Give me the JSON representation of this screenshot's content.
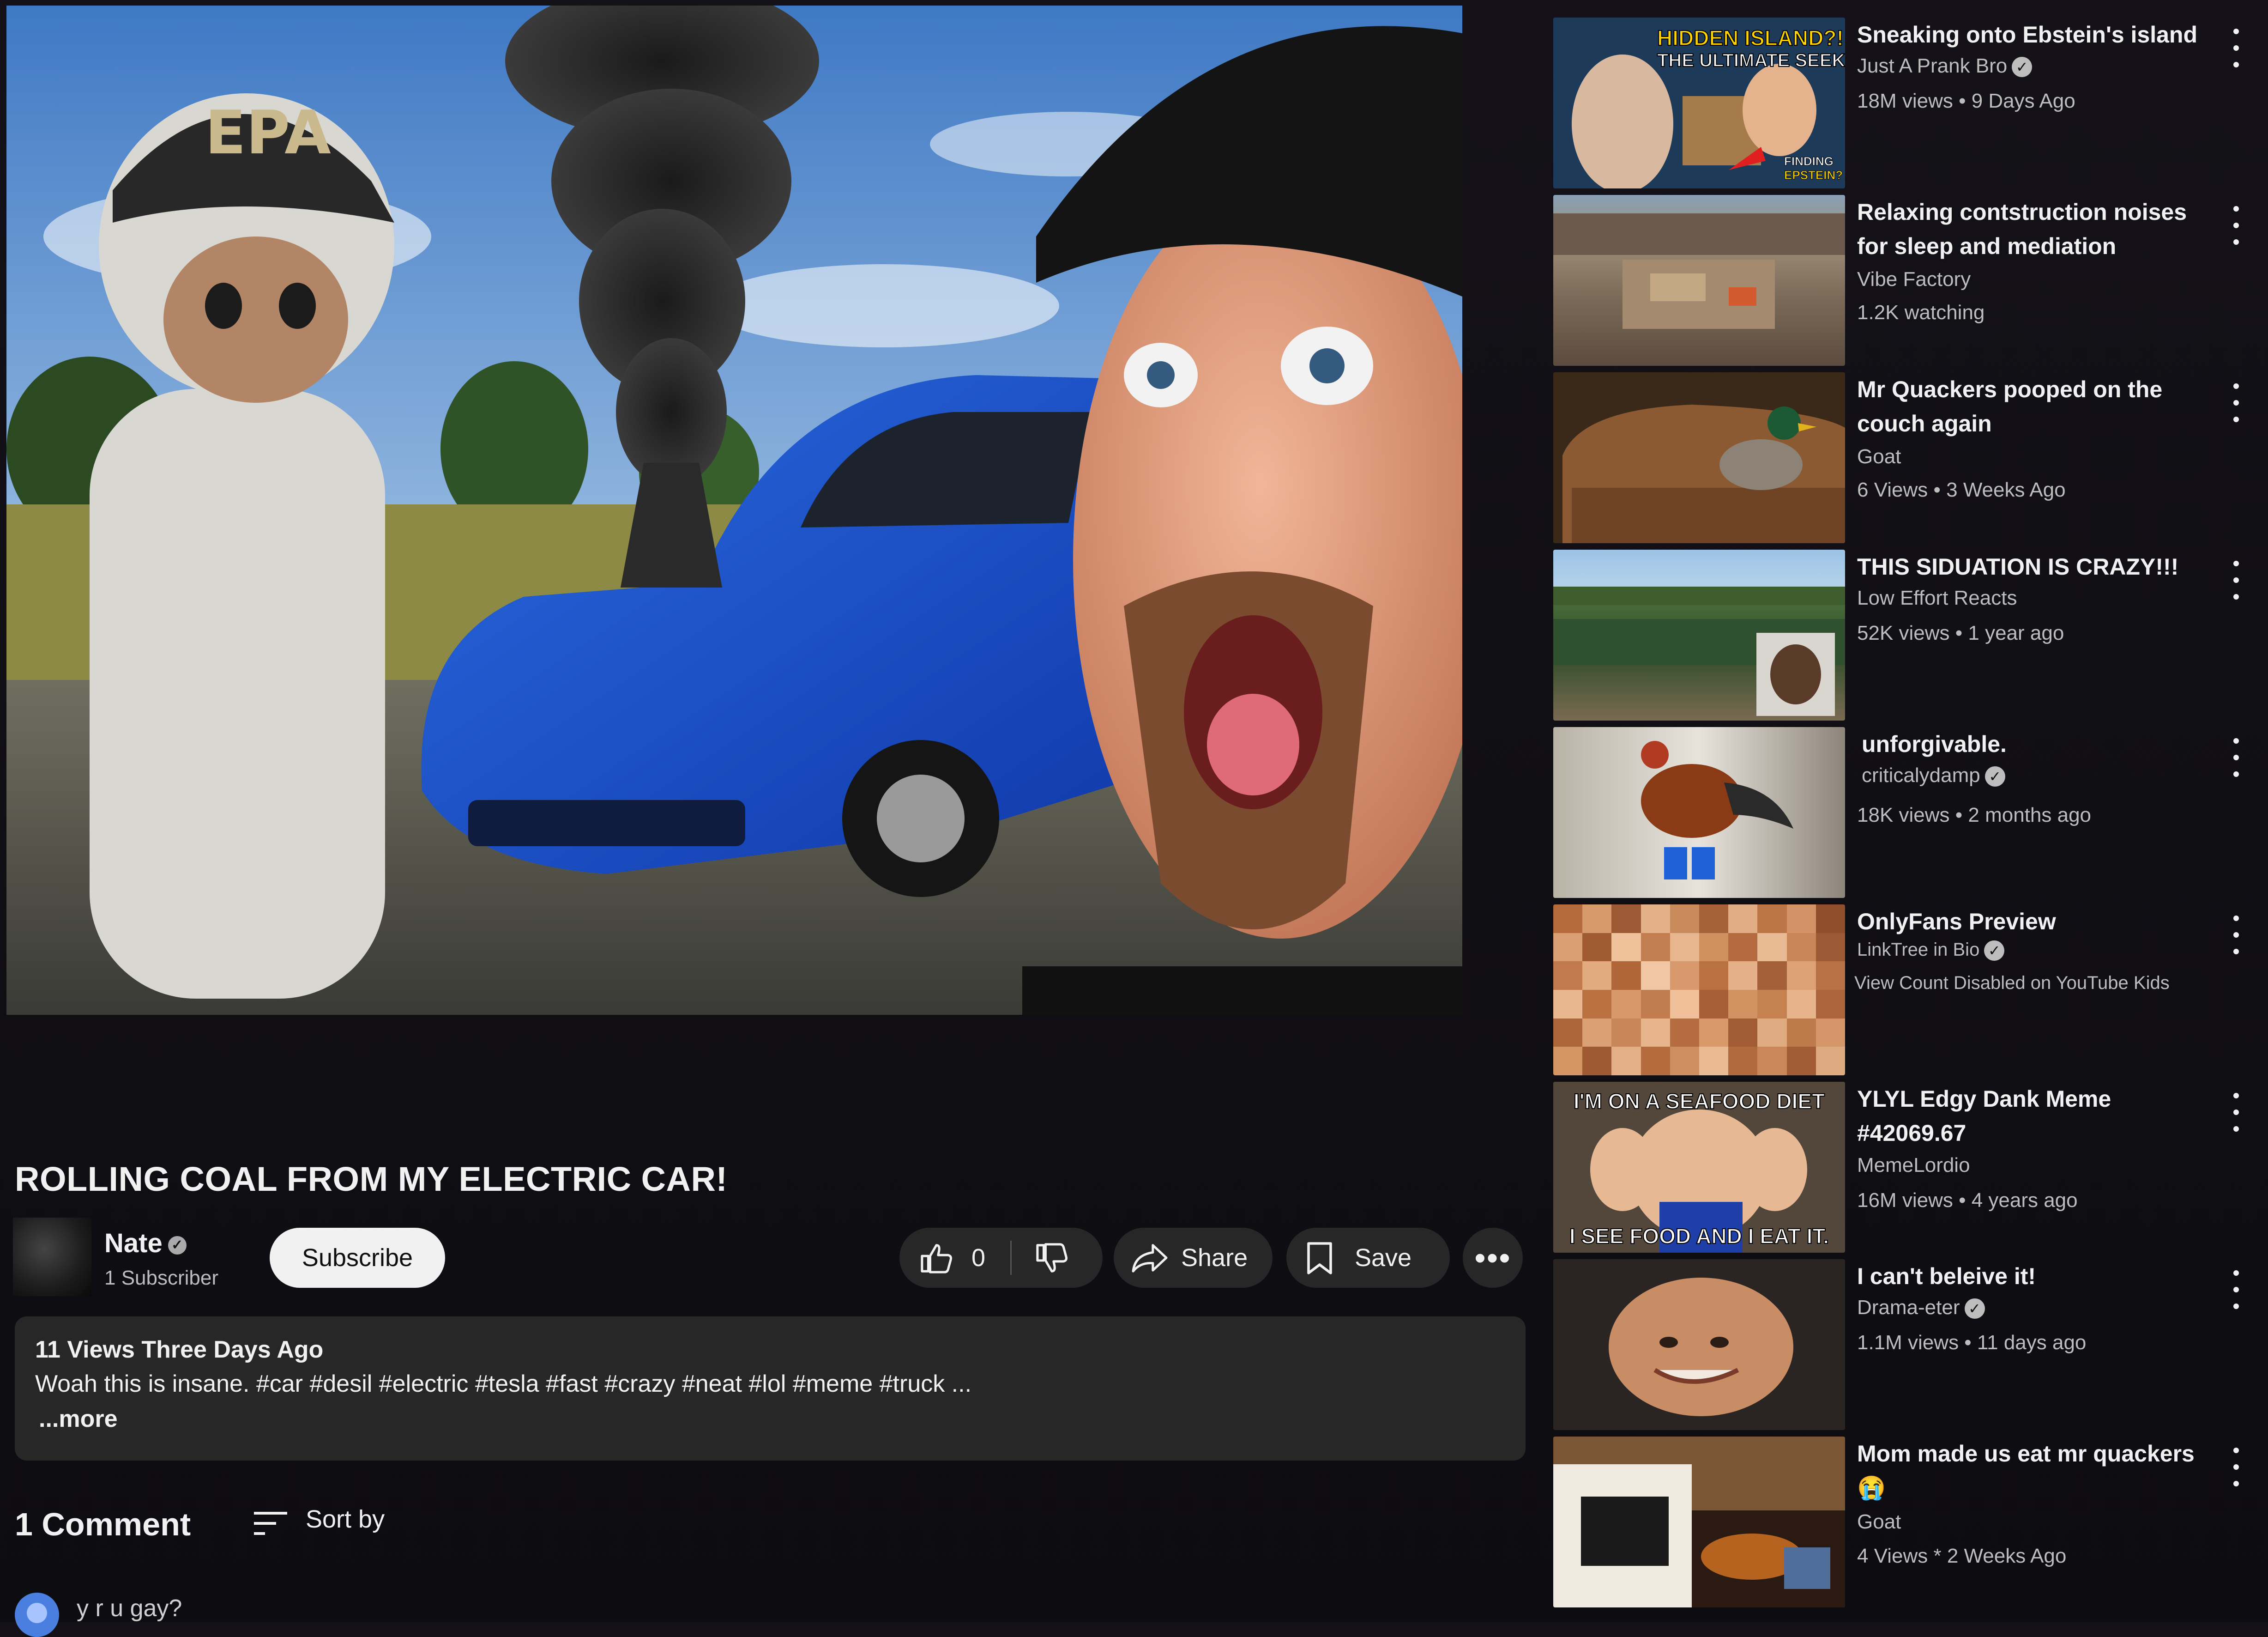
{
  "video": {
    "title": "ROLLING COAL FROM MY ELECTRIC CAR!",
    "thumbnail_text": "EPA",
    "channel": {
      "name": "Nate",
      "subscribers": "1 Subscriber"
    },
    "subscribe_label": "Subscribe",
    "likes": "0",
    "share_label": "Share",
    "save_label": "Save",
    "more_label": "•••",
    "description": {
      "meta": "11 Views  Three Days Ago",
      "body": "Woah this is insane. #car #desil #electric #tesla #fast #crazy #neat #lol #meme #truck ...",
      "more": "...more"
    }
  },
  "comments": {
    "heading": "1 Comment",
    "sort_label": "Sort by",
    "items": [
      {
        "text": "y r u gay?"
      }
    ]
  },
  "recommendations": [
    {
      "title": "Sneaking onto Ebstein's island",
      "channel": "Just A Prank Bro",
      "verified": true,
      "stats": "18M views • 9 Days Ago",
      "thumb_lines": [
        "HIDDEN ISLAND?!",
        "THE ULTIMATE SEEK!",
        "FINDING",
        "EPSTEIN?"
      ]
    },
    {
      "title": "Relaxing contstruction noises for sleep and mediation",
      "channel": "Vibe Factory",
      "verified": false,
      "stats": "1.2K watching"
    },
    {
      "title": "Mr Quackers pooped on the couch again",
      "channel": "Goat",
      "verified": false,
      "stats": "6 Views • 3 Weeks Ago"
    },
    {
      "title": "THIS SIDUATION IS CRAZY!!!",
      "channel": "Low Effort Reacts",
      "verified": false,
      "stats": "52K views • 1 year ago"
    },
    {
      "title": "unforgivable.",
      "channel": "criticalydamp",
      "verified": true,
      "stats": "18K views • 2 months ago"
    },
    {
      "title": "OnlyFans Preview",
      "channel": "LinkTree in Bio",
      "verified": true,
      "stats": "View Count Disabled on YouTube Kids"
    },
    {
      "title": "YLYL Edgy Dank Meme #42069.67",
      "channel": "MemeLordio",
      "verified": false,
      "stats": "16M views • 4 years ago",
      "thumb_lines": [
        "I'M ON A SEAFOOD DIET",
        "I SEE FOOD AND I EAT IT."
      ]
    },
    {
      "title": "I can't beleive it!",
      "channel": "Drama-eter",
      "verified": true,
      "stats": "1.1M views • 11 days ago"
    },
    {
      "title": "Mom made us eat mr quackers 😭",
      "channel": "Goat",
      "verified": false,
      "stats": "4 Views * 2 Weeks Ago"
    }
  ],
  "icons": {
    "like": "thumbs-up-icon",
    "dislike": "thumbs-down-icon",
    "share": "share-arrow-icon",
    "save": "bookmark-icon",
    "sort": "sort-lines-icon",
    "menu": "vertical-dots-icon",
    "verified": "checkmark-badge-icon"
  }
}
